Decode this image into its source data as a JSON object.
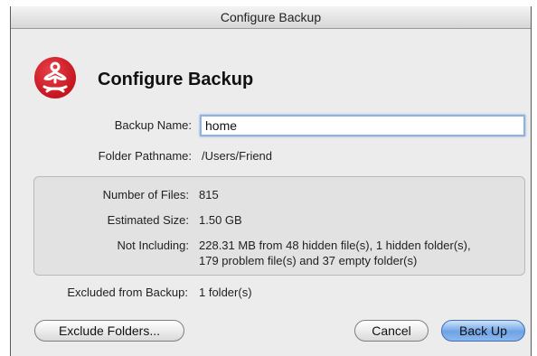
{
  "window": {
    "title": "Configure Backup"
  },
  "header": {
    "title": "Configure Backup",
    "logo_icon": "meditation-figure-icon"
  },
  "form": {
    "backup_name_label": "Backup Name:",
    "backup_name_value": "home",
    "folder_pathname_label": "Folder Pathname:",
    "folder_pathname_value": "/Users/Friend"
  },
  "summary": {
    "number_of_files_label": "Number of Files:",
    "number_of_files_value": "815",
    "estimated_size_label": "Estimated Size:",
    "estimated_size_value": "1.50 GB",
    "not_including_label": "Not Including:",
    "not_including_line1": "228.31 MB from 48 hidden file(s), 1 hidden folder(s),",
    "not_including_line2": "179 problem file(s) and 37 empty folder(s)"
  },
  "excluded": {
    "label": "Excluded from Backup:",
    "value": "1 folder(s)"
  },
  "buttons": {
    "exclude_folders": "Exclude Folders...",
    "cancel": "Cancel",
    "back_up": "Back Up"
  },
  "colors": {
    "logo_red": "#d21d27",
    "primary_button": "#6fa3e6",
    "focus_ring": "#8fb2e0"
  }
}
